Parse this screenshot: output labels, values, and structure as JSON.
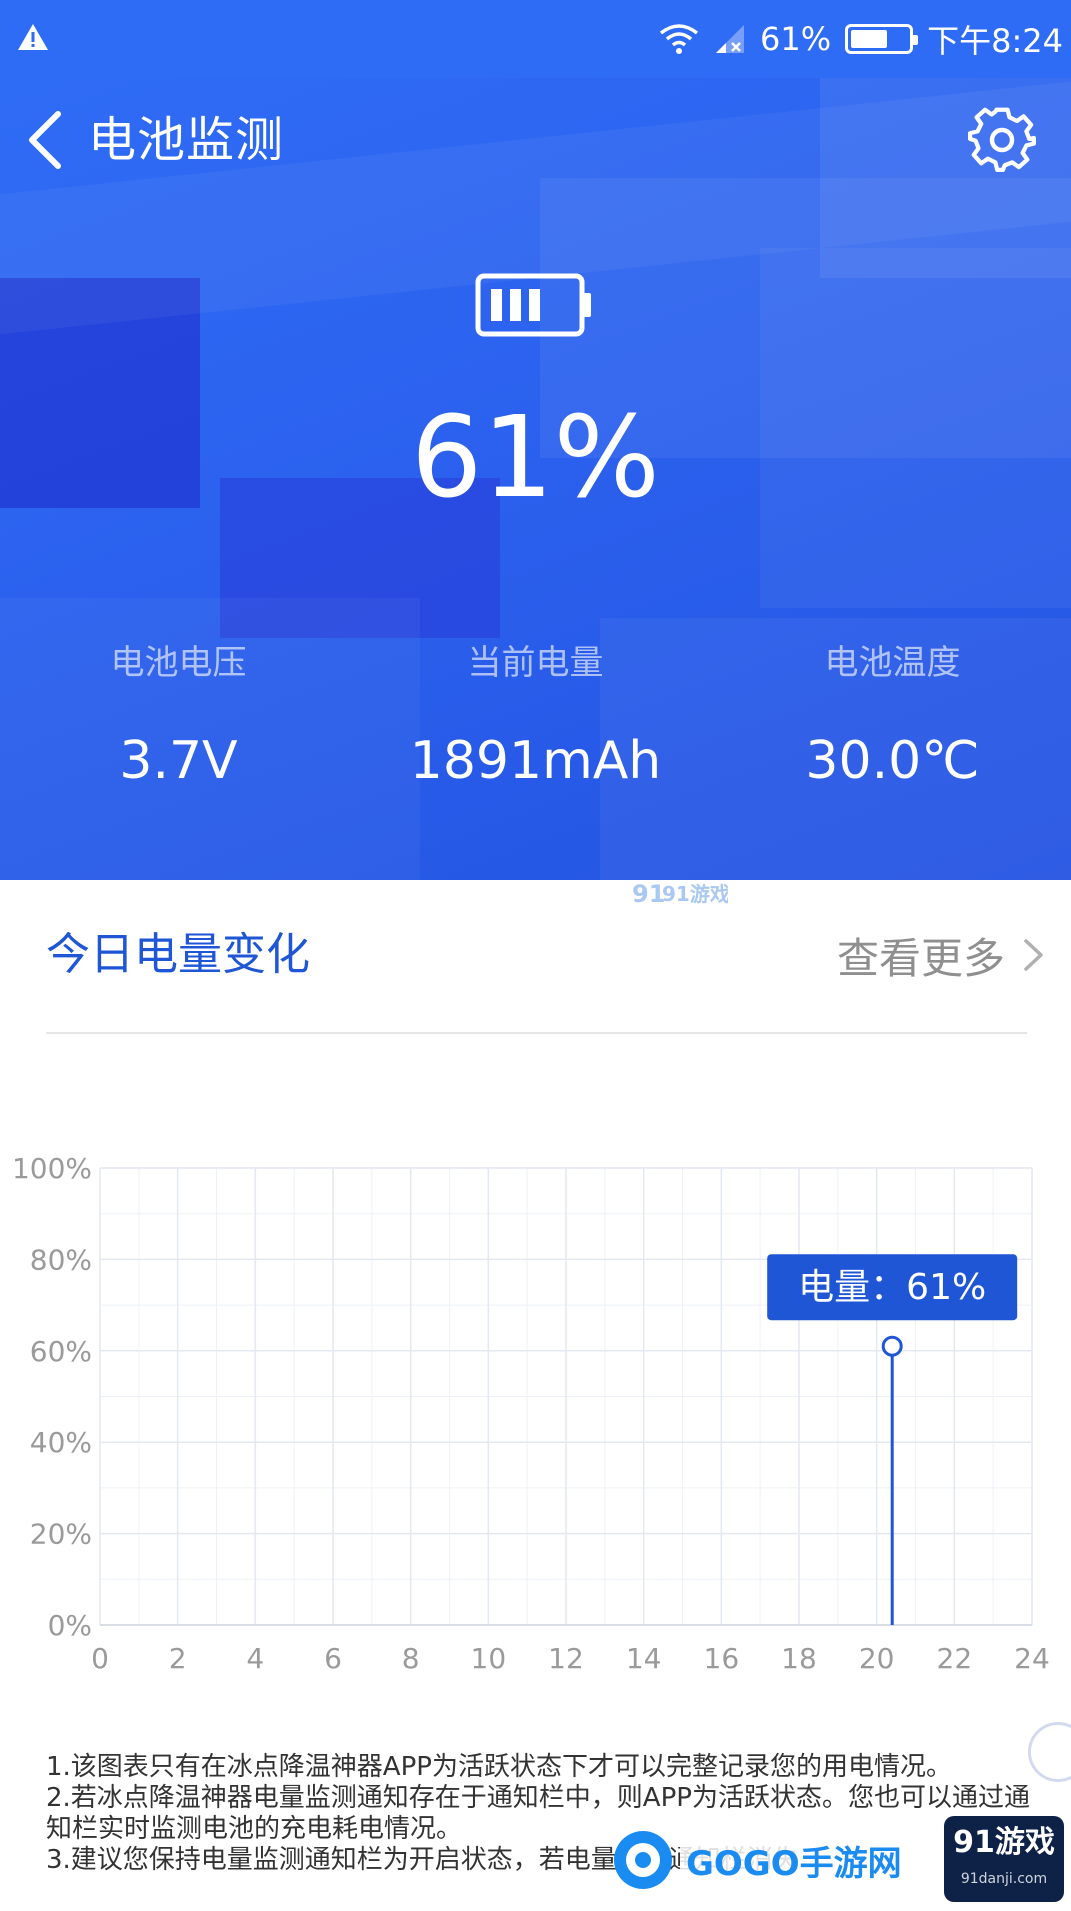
{
  "status_bar": {
    "battery_percent": "61%",
    "time": "下午8:24",
    "battery_level": 0.61
  },
  "header": {
    "title": "电池监测"
  },
  "battery": {
    "percent": "61%"
  },
  "stats": [
    {
      "label": "电池电压",
      "value": "3.7V"
    },
    {
      "label": "当前电量",
      "value": "1891mAh"
    },
    {
      "label": "电池温度",
      "value": "30.0℃"
    }
  ],
  "section": {
    "title": "今日电量变化",
    "more_label": "查看更多"
  },
  "chart_data": {
    "type": "line",
    "x_ticks": [
      "0",
      "2",
      "4",
      "6",
      "8",
      "10",
      "12",
      "14",
      "16",
      "18",
      "20",
      "22",
      "24"
    ],
    "y_ticks": [
      "0%",
      "20%",
      "40%",
      "60%",
      "80%",
      "100%"
    ],
    "xlim": [
      0,
      24
    ],
    "ylim": [
      0,
      100
    ],
    "grid": true,
    "points": [
      {
        "x": 20.4,
        "y": 61
      }
    ],
    "tooltip": "电量：61%",
    "line_color": "#1f56d6"
  },
  "notes": [
    "1.该图表只有在冰点降温神器APP为活跃状态下才可以完整记录您的用电情况。",
    "2.若冰点降温神器电量监测通知存在于通知栏中，则APP为活跃状态。您也可以通过通知栏实时监测电池的充电耗电情况。",
    "3.建议您保持电量监测通知栏为开启状态，若电量监测通知栏消失"
  ],
  "watermarks": {
    "top": "91游戏",
    "gogo": "GOGO手游网",
    "brand": "91游戏",
    "brand_sub": "91danji.com"
  },
  "colors": {
    "accent": "#2f6cf5",
    "title_blue": "#1f56d6"
  }
}
